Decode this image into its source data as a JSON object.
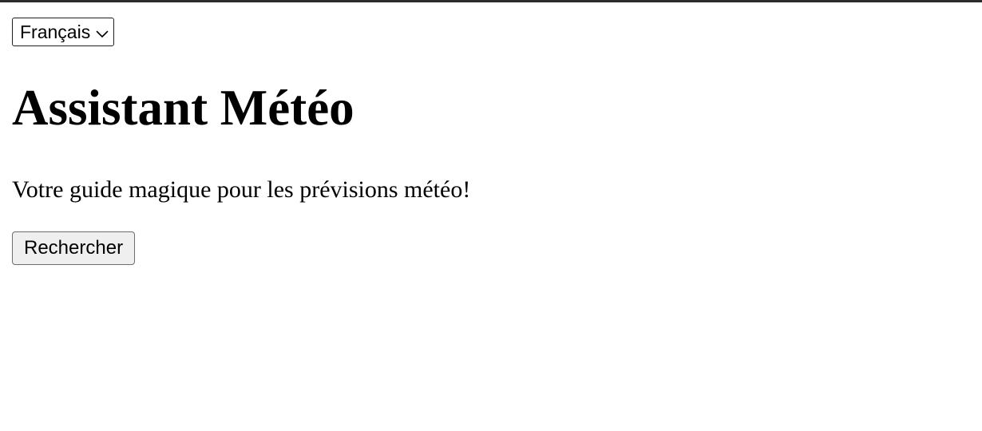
{
  "language_selector": {
    "selected": "Français",
    "icon": "chevron-down-icon"
  },
  "header": {
    "title": "Assistant Météo",
    "subtitle": "Votre guide magique pour les prévisions météo!"
  },
  "actions": {
    "search_label": "Rechercher"
  },
  "colors": {
    "top_border": "#2b2b2b",
    "button_background": "#efefef",
    "text": "#000000"
  }
}
